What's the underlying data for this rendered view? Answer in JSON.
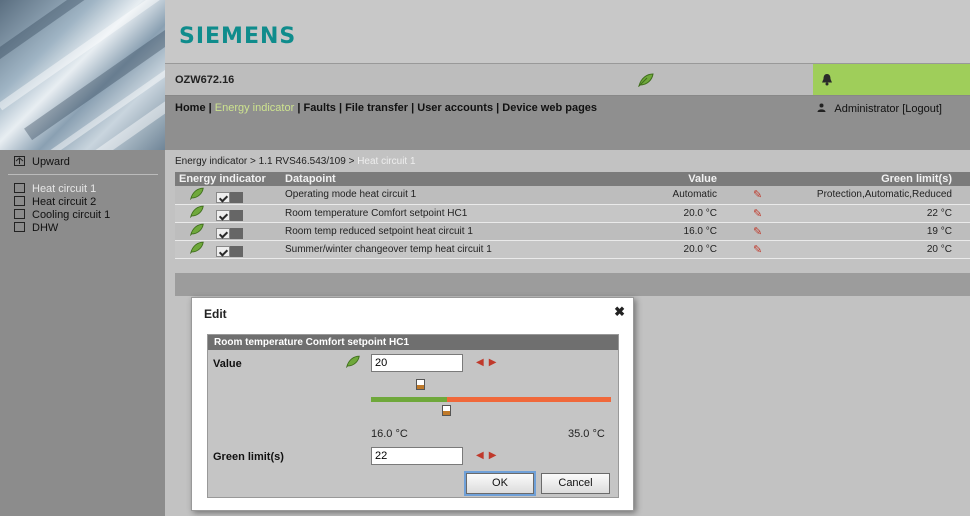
{
  "brand": "SIEMENS",
  "device": "OZW672.16",
  "nav": {
    "home": "Home",
    "energy": "Energy indicator",
    "faults": "Faults",
    "file_transfer": "File transfer",
    "user_accounts": "User accounts",
    "device_web_pages": "Device web pages",
    "sep": "|",
    "user": "Administrator",
    "logout": "[Logout]"
  },
  "sidebar": {
    "upward": "Upward",
    "items": [
      {
        "label": "Heat circuit 1",
        "active": true
      },
      {
        "label": "Heat circuit 2",
        "active": false
      },
      {
        "label": "Cooling circuit 1",
        "active": false
      },
      {
        "label": "DHW",
        "active": false
      }
    ]
  },
  "breadcrumb": {
    "part1": "Energy indicator",
    "sep": ">",
    "part2": "1.1 RVS46.543/109",
    "part3": "Heat circuit 1"
  },
  "table": {
    "headers": {
      "energy": "Energy indicator",
      "datapoint": "Datapoint",
      "value": "Value",
      "green": "Green limit(s)"
    },
    "rows": [
      {
        "datapoint": "Operating mode heat circuit 1",
        "value": "Automatic",
        "green": "Protection,Automatic,Reduced"
      },
      {
        "datapoint": "Room temperature Comfort setpoint HC1",
        "value": "20.0 °C",
        "green": "22 °C"
      },
      {
        "datapoint": "Room temp reduced setpoint heat circuit 1",
        "value": "16.0 °C",
        "green": "19 °C"
      },
      {
        "datapoint": "Summer/winter changeover temp heat circuit 1",
        "value": "20.0 °C",
        "green": "20 °C"
      }
    ]
  },
  "dialog": {
    "title": "Edit",
    "panel_title": "Room temperature Comfort setpoint HC1",
    "value_label": "Value",
    "value": "20",
    "min_label": "16.0 °C",
    "max_label": "35.0 °C",
    "value_fraction": 0.21,
    "green_fraction": 0.316,
    "green_label": "Green limit(s)",
    "green_value": "22",
    "ok": "OK",
    "cancel": "Cancel"
  },
  "colors": {
    "accent_green": "#6fa83b",
    "alarm_bar": "#9fce5a",
    "brand_teal": "#0f8c8c",
    "slider_orange": "#f0683a"
  }
}
